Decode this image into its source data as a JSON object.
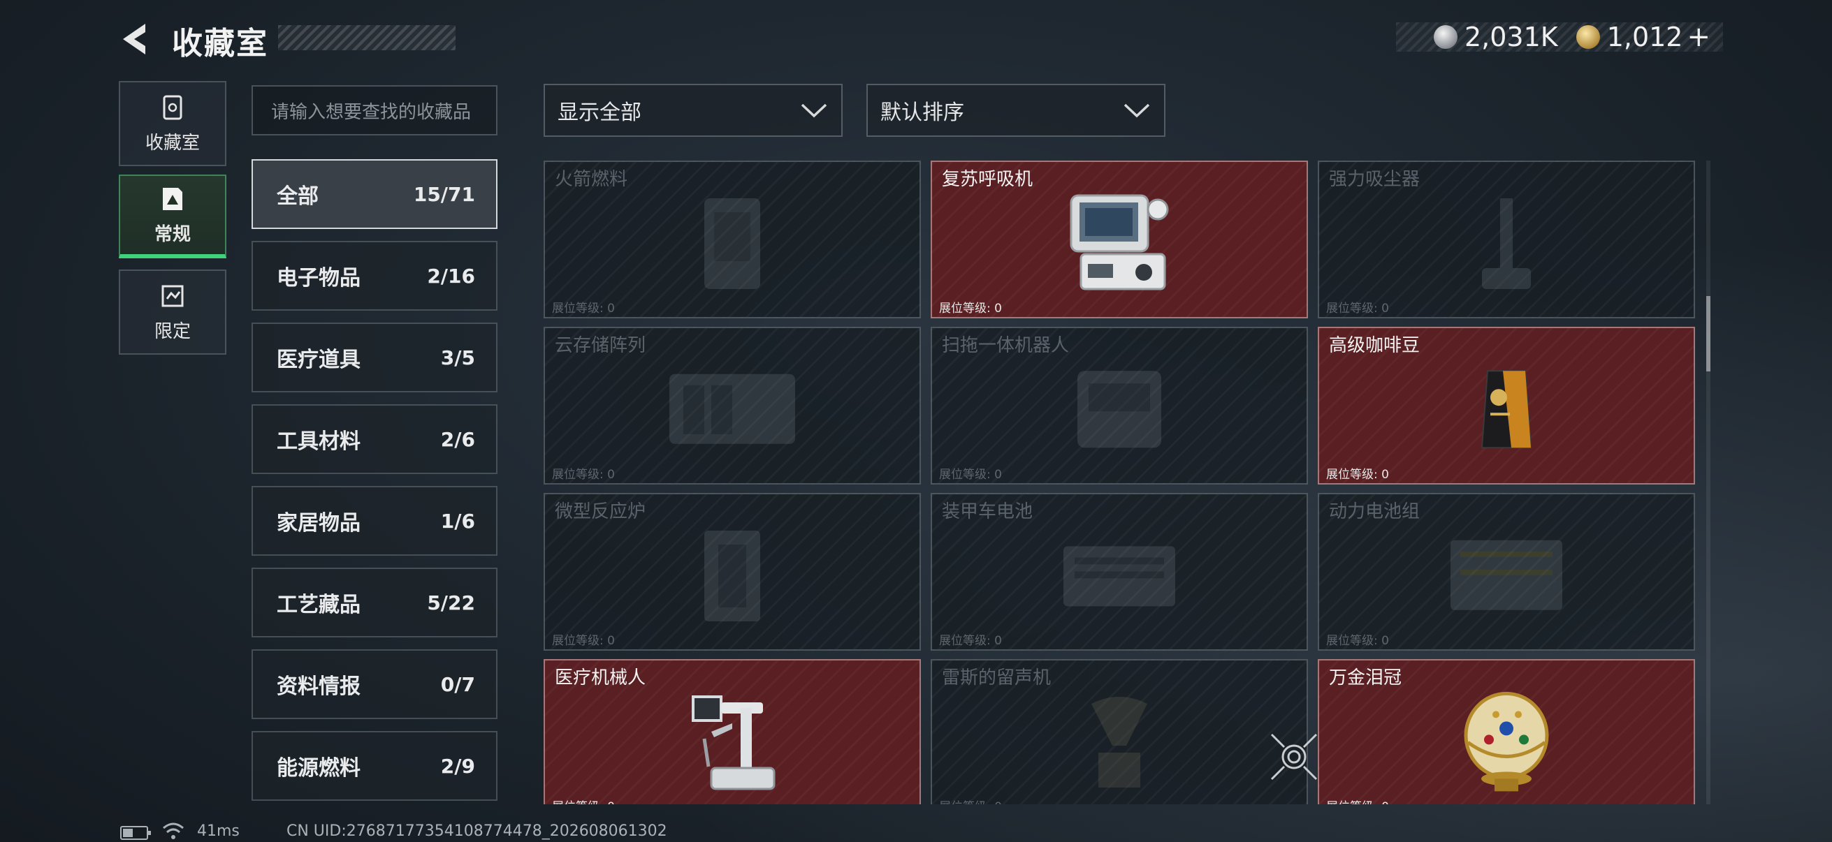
{
  "header": {
    "title": "收藏室",
    "currencies": [
      {
        "icon": "silver-coin-icon",
        "value": "2,031K"
      },
      {
        "icon": "gold-coin-icon",
        "value": "1,012"
      }
    ],
    "add_symbol": "+"
  },
  "side_tabs": [
    {
      "label": "收藏室",
      "icon": "collection-room-icon",
      "active": false
    },
    {
      "label": "常规",
      "icon": "regular-collection-icon",
      "active": true
    },
    {
      "label": "限定",
      "icon": "limited-collection-icon",
      "active": false
    }
  ],
  "search": {
    "placeholder": "请输入想要查找的收藏品"
  },
  "categories": [
    {
      "label": "全部",
      "count": "15/71",
      "active": true
    },
    {
      "label": "电子物品",
      "count": "2/16"
    },
    {
      "label": "医疗道具",
      "count": "3/5"
    },
    {
      "label": "工具材料",
      "count": "2/6"
    },
    {
      "label": "家居物品",
      "count": "1/6"
    },
    {
      "label": "工艺藏品",
      "count": "5/22"
    },
    {
      "label": "资料情报",
      "count": "0/7"
    },
    {
      "label": "能源燃料",
      "count": "2/9"
    }
  ],
  "filters": {
    "display": "显示全部",
    "sort": "默认排序"
  },
  "level_label": "展位等级: 0",
  "items": [
    {
      "name": "火箭燃料",
      "owned": false,
      "icon": "rocket-fuel-icon"
    },
    {
      "name": "复苏呼吸机",
      "owned": true,
      "icon": "ventilator-icon"
    },
    {
      "name": "强力吸尘器",
      "owned": false,
      "icon": "vacuum-cleaner-icon"
    },
    {
      "name": "云存储阵列",
      "owned": false,
      "icon": "storage-array-icon"
    },
    {
      "name": "扫拖一体机器人",
      "owned": false,
      "icon": "robot-vacuum-icon"
    },
    {
      "name": "高级咖啡豆",
      "owned": true,
      "icon": "coffee-bag-icon"
    },
    {
      "name": "微型反应炉",
      "owned": false,
      "icon": "mini-reactor-icon"
    },
    {
      "name": "装甲车电池",
      "owned": false,
      "icon": "vehicle-battery-icon"
    },
    {
      "name": "动力电池组",
      "owned": false,
      "icon": "battery-pack-icon"
    },
    {
      "name": "医疗机械人",
      "owned": true,
      "icon": "medical-robot-icon"
    },
    {
      "name": "雷斯的留声机",
      "owned": false,
      "icon": "gramophone-icon"
    },
    {
      "name": "万金泪冠",
      "owned": true,
      "icon": "jeweled-egg-icon"
    }
  ],
  "footer": {
    "ping": "41ms",
    "uid": "CN UID:27687177354108774478_202608061302"
  },
  "colors": {
    "accent": "#3fd27a",
    "owned_card": "#5a1f22",
    "locked_card": "#181e24"
  }
}
